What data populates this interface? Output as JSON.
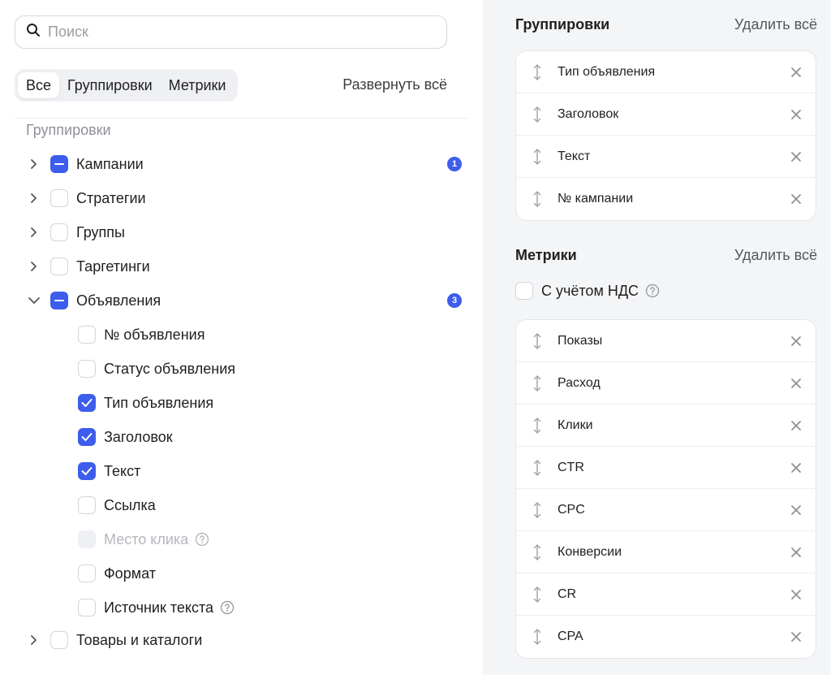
{
  "search": {
    "placeholder": "Поиск",
    "value": ""
  },
  "tabs": [
    {
      "label": "Все",
      "active": true
    },
    {
      "label": "Группировки",
      "active": false
    },
    {
      "label": "Метрики",
      "active": false
    }
  ],
  "expand_all_label": "Развернуть всё",
  "groupings_section_label": "Группировки",
  "tree": {
    "campaigns": {
      "label": "Кампании",
      "state": "partial",
      "badge": "1",
      "expanded": false
    },
    "strategies": {
      "label": "Стратегии",
      "state": "unchecked",
      "expanded": false
    },
    "groups": {
      "label": "Группы",
      "state": "unchecked",
      "expanded": false
    },
    "targetings": {
      "label": "Таргетинги",
      "state": "unchecked",
      "expanded": false
    },
    "ads": {
      "label": "Объявления",
      "state": "partial",
      "badge": "3",
      "expanded": true,
      "children": [
        {
          "label": "№ объявления",
          "state": "unchecked"
        },
        {
          "label": "Статус объявления",
          "state": "unchecked"
        },
        {
          "label": "Тип объявления",
          "state": "checked"
        },
        {
          "label": "Заголовок",
          "state": "checked"
        },
        {
          "label": "Текст",
          "state": "checked"
        },
        {
          "label": "Ссылка",
          "state": "unchecked"
        },
        {
          "label": "Место клика",
          "state": "disabled",
          "help": true
        },
        {
          "label": "Формат",
          "state": "unchecked"
        },
        {
          "label": "Источник текста",
          "state": "unchecked",
          "help": true
        }
      ]
    },
    "goods": {
      "label": "Товары и каталоги",
      "state": "unchecked",
      "expanded": false
    }
  },
  "right": {
    "groupings": {
      "title": "Группировки",
      "delete_all": "Удалить всё",
      "items": [
        "Тип объявления",
        "Заголовок",
        "Текст",
        "№ кампании"
      ]
    },
    "metrics": {
      "title": "Метрики",
      "delete_all": "Удалить всё",
      "vat_label": "С учётом НДС",
      "vat_checked": false,
      "items": [
        "Показы",
        "Расход",
        "Клики",
        "CTR",
        "CPC",
        "Конверсии",
        "CR",
        "CPA"
      ]
    }
  },
  "colors": {
    "accent": "#3d5ded",
    "panel_bg": "#f4f5f7",
    "muted_text": "#8f9197"
  }
}
